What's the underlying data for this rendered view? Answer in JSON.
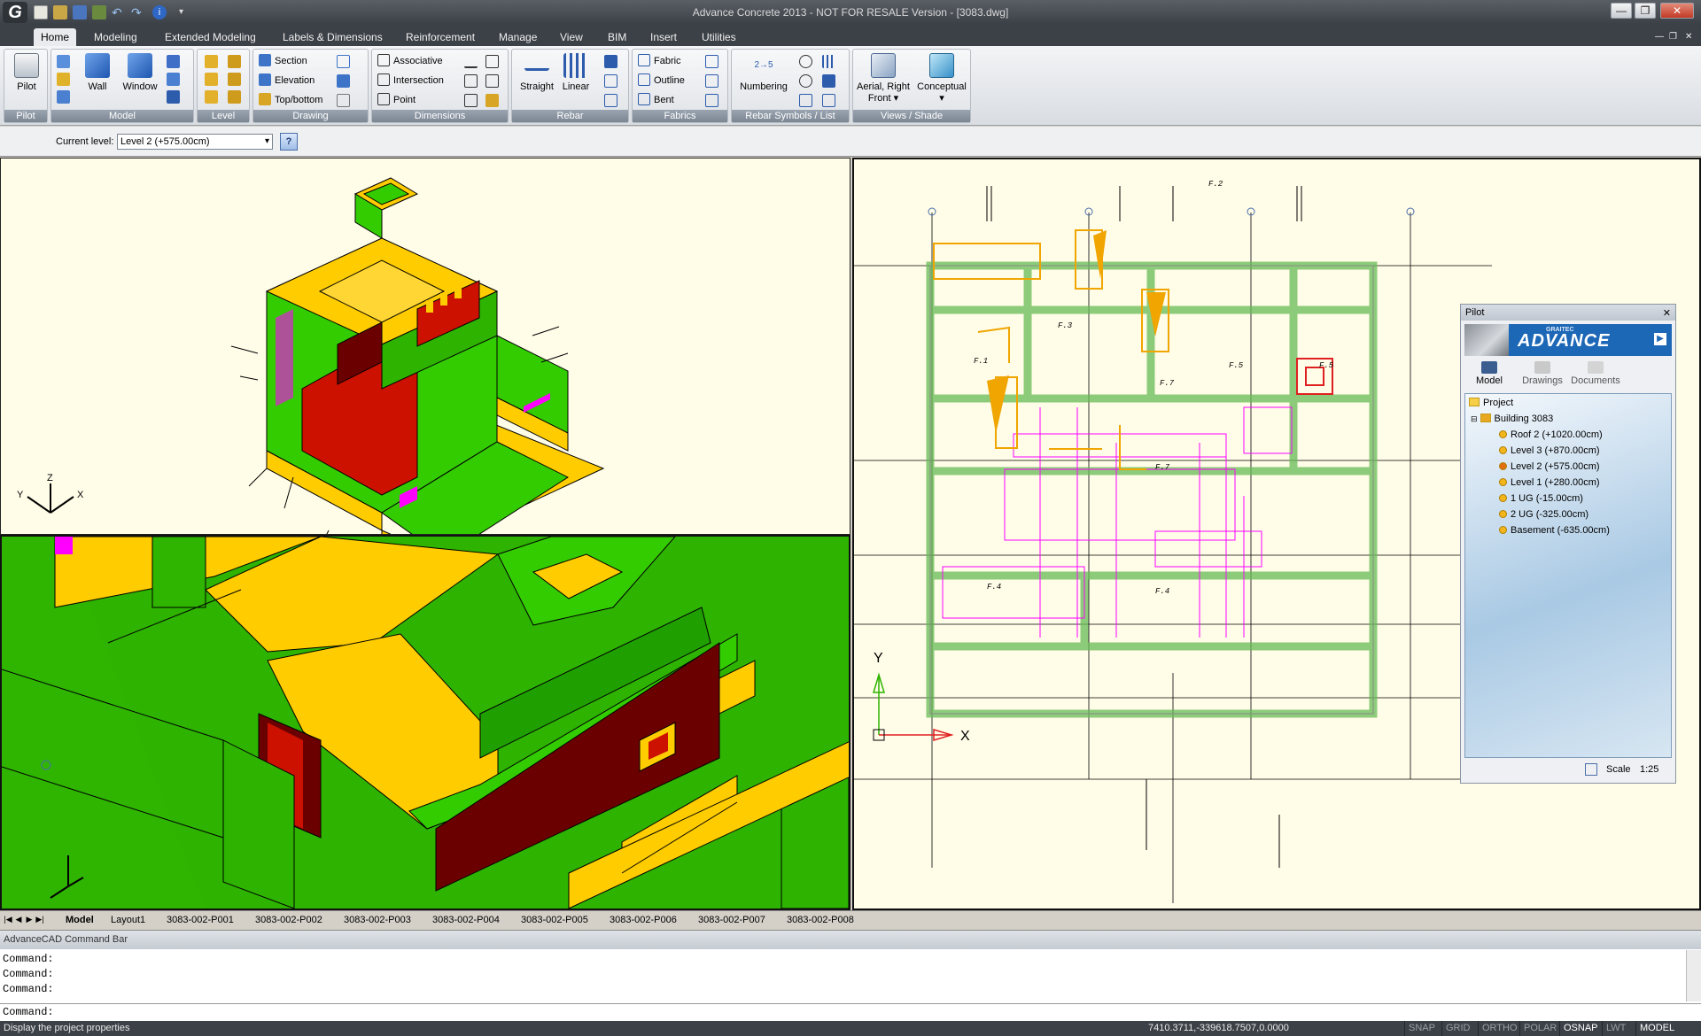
{
  "window": {
    "title": "Advance Concrete 2013 - NOT FOR RESALE Version - [3083.dwg]",
    "logo": "G",
    "controls": [
      "—",
      "❐",
      "✕"
    ],
    "doc_controls": [
      "—",
      "❐",
      "✕"
    ]
  },
  "tabs": [
    "Home",
    "Modeling",
    "Extended Modeling",
    "Labels & Dimensions",
    "Reinforcement",
    "Manage",
    "View",
    "BIM",
    "Insert",
    "Utilities"
  ],
  "ribbon": {
    "pilot": {
      "button": "Pilot",
      "label": "Pilot"
    },
    "model": {
      "wall": "Wall",
      "window": "Window",
      "label": "Model"
    },
    "level": {
      "label": "Level"
    },
    "drawing": {
      "section": "Section",
      "elevation": "Elevation",
      "topbottom": "Top/bottom",
      "label": "Drawing"
    },
    "dimensions": {
      "associative": "Associative",
      "intersection": "Intersection",
      "point": "Point",
      "label": "Dimensions"
    },
    "rebar": {
      "straight": "Straight",
      "linear": "Linear",
      "label": "Rebar"
    },
    "fabrics": {
      "fabric": "Fabric",
      "outline": "Outline",
      "bent": "Bent",
      "label": "Fabrics"
    },
    "rebarsymbols": {
      "numbering": "Numbering",
      "label": "Rebar Symbols / List"
    },
    "views": {
      "aerial": "Aerial, Right Front",
      "conceptual": "Conceptual",
      "label": "Views / Shade"
    }
  },
  "levelbar": {
    "label": "Current level:",
    "value": "Level 2 (+575.00cm)",
    "props_icon": "?"
  },
  "viewports": {
    "iso_axes": {
      "x": "X",
      "y": "Y",
      "z": "Z"
    },
    "plan_axes": {
      "x": "X",
      "y": "Y"
    }
  },
  "pilot": {
    "title": "Pilot",
    "close": "✕",
    "banner_small": "GRAITEC",
    "banner_text": "ADVANCE",
    "tabs": [
      "Model",
      "Drawings",
      "Documents"
    ],
    "tree": {
      "root": "Project",
      "building": "Building 3083",
      "levels": [
        "Roof 2 (+1020.00cm)",
        "Level 3 (+870.00cm)",
        "Level 2 (+575.00cm)",
        "Level 1 (+280.00cm)",
        "1 UG (-15.00cm)",
        "2 UG (-325.00cm)",
        "Basement (-635.00cm)"
      ]
    },
    "scale_label": "Scale",
    "scale_value": "1:25"
  },
  "layout_tabs": [
    "Model",
    "Layout1",
    "3083-002-P001",
    "3083-002-P002",
    "3083-002-P003",
    "3083-002-P004",
    "3083-002-P005",
    "3083-002-P006",
    "3083-002-P007",
    "3083-002-P008"
  ],
  "command_bar": {
    "title": "AdvanceCAD Command Bar",
    "history": [
      "Command:",
      "Command:",
      "Command:"
    ],
    "prompt": "Command:"
  },
  "status": {
    "message": "Display the project properties",
    "coords": "7410.3711,-339618.7507,0.0000",
    "toggles": [
      "SNAP",
      "GRID",
      "ORTHO",
      "POLAR",
      "OSNAP",
      "LWT",
      "MODEL"
    ]
  },
  "colors": {
    "green": "#33cc00",
    "yellow": "#ffcc00",
    "red": "#cc1100",
    "darkred": "#6a0000",
    "magenta": "#ff00ff",
    "canvas": "#fffde8"
  }
}
